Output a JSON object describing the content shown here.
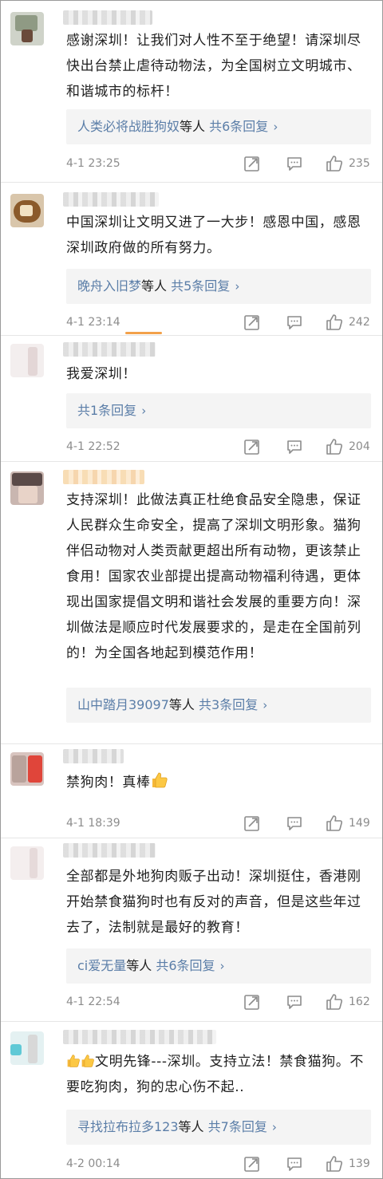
{
  "comments": [
    {
      "text": "感谢深圳！让我们对人性不至于绝望！请深圳尽快出台禁止虐待动物法，为全国树立文明城市、和谐城市的标杆！",
      "reply_users": "人类必将战胜狗奴",
      "reply_suffix": "等人",
      "reply_count": "共6条回复",
      "time": "4-1 23:25",
      "likes": "235"
    },
    {
      "text": "中国深圳让文明又进了一大步！感恩中国，感恩深圳政府做的所有努力。",
      "reply_users": "晚舟入旧梦",
      "reply_suffix": "等人",
      "reply_count": "共5条回复",
      "time": "4-1 23:14",
      "likes": "242"
    },
    {
      "text": "我爱深圳！",
      "reply_users": "",
      "reply_suffix": "",
      "reply_count": "共1条回复",
      "time": "4-1 22:52",
      "likes": "204"
    },
    {
      "text": "支持深圳！此做法真正杜绝食品安全隐患，保证人民群众生命安全，提高了深圳文明形象。猫狗伴侣动物对人类贡献更超出所有动物，更该禁止食用！国家农业部提出提高动物福利待遇，更体现出国家提倡文明和谐社会发展的重要方向！深圳做法是顺应时代发展要求的，是走在全国前列的！为全国各地起到模范作用！",
      "reply_users": "山中踏月39097",
      "reply_suffix": "等人",
      "reply_count": "共3条回复",
      "time": "",
      "likes": ""
    },
    {
      "text": "禁狗肉！真棒",
      "reply_users": "",
      "reply_suffix": "",
      "reply_count": "",
      "time": "4-1 18:39",
      "likes": "149"
    },
    {
      "text": "全部都是外地狗肉贩子出动！深圳挺住，香港刚开始禁食猫狗时也有反对的声音，但是这些年过去了，法制就是最好的教育！",
      "reply_users": "ci爱无量",
      "reply_suffix": "等人",
      "reply_count": "共6条回复",
      "time": "4-1 22:54",
      "likes": "162"
    },
    {
      "text": "文明先锋---深圳。支持立法！禁食猫狗。不要吃狗肉，狗的忠心伤不起..",
      "reply_users": "寻找拉布拉多123",
      "reply_suffix": "等人",
      "reply_count": "共7条回复",
      "time": "4-2 00:14",
      "likes": "139"
    }
  ],
  "icons": {
    "share": "share-icon",
    "comment": "comment-icon",
    "like": "thumbs-up-icon",
    "thumbs_emoji": "thumbs-up-emoji",
    "chevron": "chevron-right-icon"
  },
  "colors": {
    "link": "#5b7ea8",
    "reply_bg": "#f4f4f4",
    "meta": "#8c8c8c",
    "scroll_indicator": "#f2a14a"
  }
}
